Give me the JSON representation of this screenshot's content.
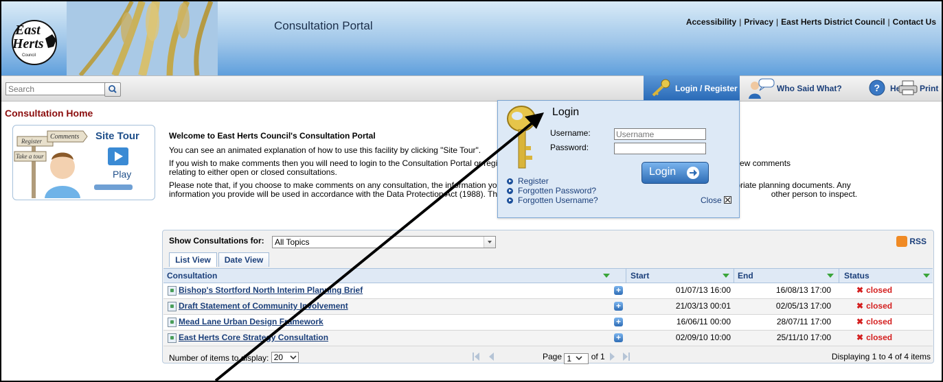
{
  "header": {
    "title": "Consultation Portal",
    "logo_text": "East Herts Council",
    "links": [
      "Accessibility",
      "Privacy",
      "East Herts District Council",
      "Contact Us"
    ],
    "separator": "|"
  },
  "toolbar": {
    "search_placeholder": "Search",
    "login_register": "Login / Register",
    "who_said_what": "Who Said What?",
    "help": "Help",
    "print": "Print"
  },
  "sidebar": {
    "home_title": "Consultation Home",
    "site_tour": {
      "title": "Site Tour",
      "play": "Play",
      "sign_comments": "Comments",
      "sign_register": "Register",
      "sign_take_a_tour": "Take a tour"
    }
  },
  "content": {
    "welcome": "Welcome to East Herts Council's Consultation Portal",
    "p1": "You can see an animated explanation of how to use this facility by clicking \"Site Tour\".",
    "p2a": "If you wish to make comments then you will need to login to the Consultation Portal or register",
    "p2b": "d to register if you would just like to view comments",
    "p2c": "relating to either open or closed consultations.",
    "p3a": "Please note that, if you choose to make comments on any consultation, the information you pr",
    "p3b": "of the appropriate planning documents.  Any",
    "p3c": "information you provide will be used in accordance with the Data Protection Act (1988).  The re",
    "p3d": "other person to inspect."
  },
  "login_popup": {
    "title": "Login",
    "username_label": "Username:",
    "username_placeholder": "Username",
    "password_label": "Password:",
    "login_button": "Login",
    "links": [
      "Register",
      "Forgotten Password?",
      "Forgotten Username?"
    ],
    "close": "Close"
  },
  "consultations": {
    "show_label": "Show Consultations for:",
    "topic": "All Topics",
    "rss": "RSS",
    "tabs": [
      "List View",
      "Date View"
    ],
    "columns": [
      "Consultation",
      "Start",
      "End",
      "Status"
    ],
    "rows": [
      {
        "name": "Bishop's Stortford North Interim Planning Brief",
        "start": "01/07/13 16:00",
        "end": "16/08/13 17:00",
        "status": "closed"
      },
      {
        "name": "Draft Statement of Community Involvement",
        "start": "21/03/13 00:01",
        "end": "02/05/13 17:00",
        "status": "closed"
      },
      {
        "name": "Mead Lane Urban Design Framework",
        "start": "16/06/11 00:00",
        "end": "28/07/11 17:00",
        "status": "closed"
      },
      {
        "name": "East Herts Core Strategy Consultation",
        "start": "02/09/10 10:00",
        "end": "25/11/10 17:00",
        "status": "closed"
      }
    ],
    "items_label": "Number of items to display:",
    "items_value": "20",
    "page_label": "Page",
    "page_value": "1",
    "page_of": "of 1",
    "displaying": "Displaying 1 to 4 of 4 items"
  },
  "colors": {
    "accent": "#2a6bb8",
    "title_red": "#8b0d0d",
    "status_closed": "#d41f1f"
  }
}
